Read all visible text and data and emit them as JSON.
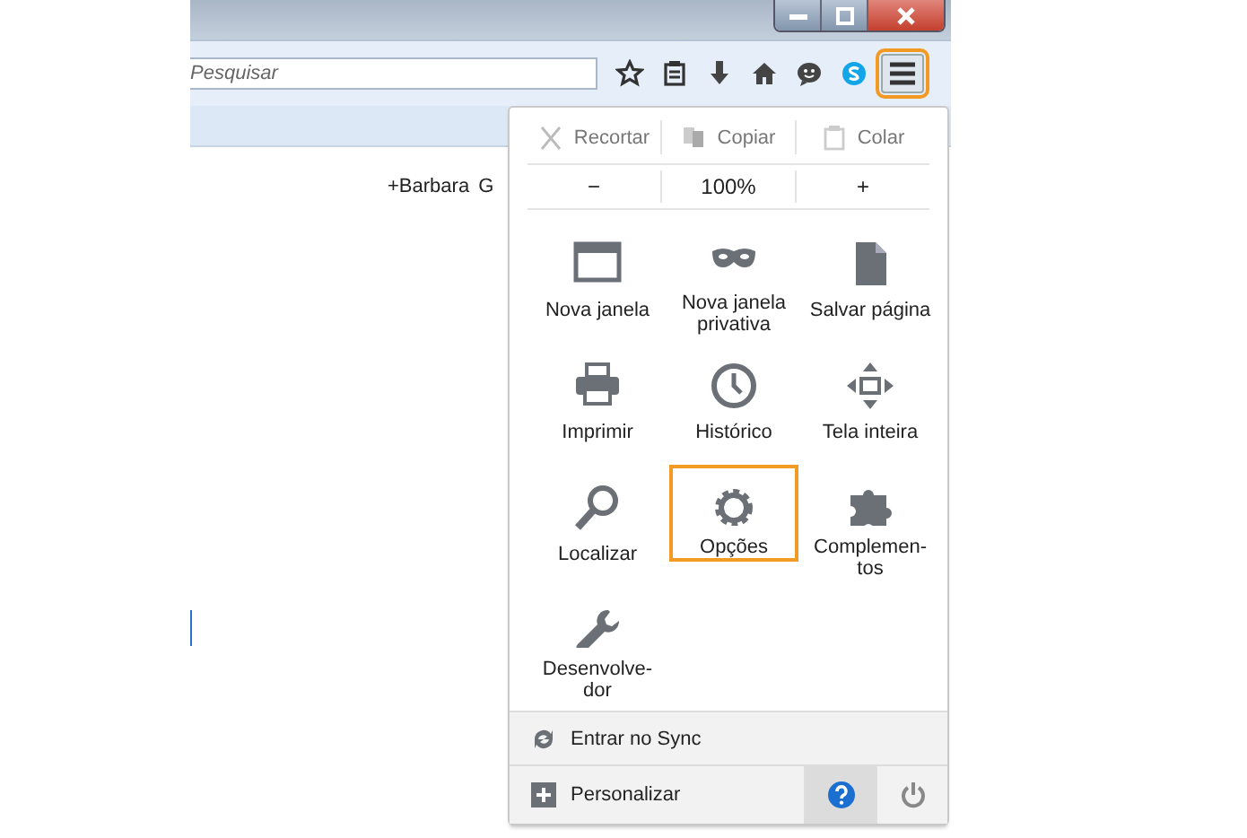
{
  "search": {
    "placeholder": "Pesquisar"
  },
  "menu_button": {
    "highlighted": true
  },
  "page": {
    "texts": [
      "+Barbara",
      "G"
    ]
  },
  "menu": {
    "edit": [
      {
        "kind": "cut",
        "label": "Recortar",
        "disabled": true
      },
      {
        "kind": "copy",
        "label": "Copiar",
        "disabled": true
      },
      {
        "kind": "paste",
        "label": "Colar",
        "disabled": true
      }
    ],
    "zoom": {
      "out": "−",
      "level": "100%",
      "in": "+"
    },
    "items": [
      {
        "kind": "window",
        "label": "Nova janela",
        "highlighted": false
      },
      {
        "kind": "mask",
        "label": "Nova janela privativa",
        "highlighted": false
      },
      {
        "kind": "page",
        "label": "Salvar página",
        "highlighted": false
      },
      {
        "kind": "printer",
        "label": "Imprimir",
        "highlighted": false
      },
      {
        "kind": "clock",
        "label": "Histórico",
        "highlighted": false
      },
      {
        "kind": "fullscreen",
        "label": "Tela inteira",
        "highlighted": false
      },
      {
        "kind": "search",
        "label": "Localizar",
        "highlighted": false
      },
      {
        "kind": "gear",
        "label": "Opções",
        "highlighted": true
      },
      {
        "kind": "puzzle",
        "label": "Complemen-tos",
        "highlighted": false
      },
      {
        "kind": "wrench",
        "label": "Desenvolve-dor",
        "highlighted": false
      }
    ],
    "sync": "Entrar no Sync",
    "customize": "Personalizar",
    "help_pressed": true
  }
}
